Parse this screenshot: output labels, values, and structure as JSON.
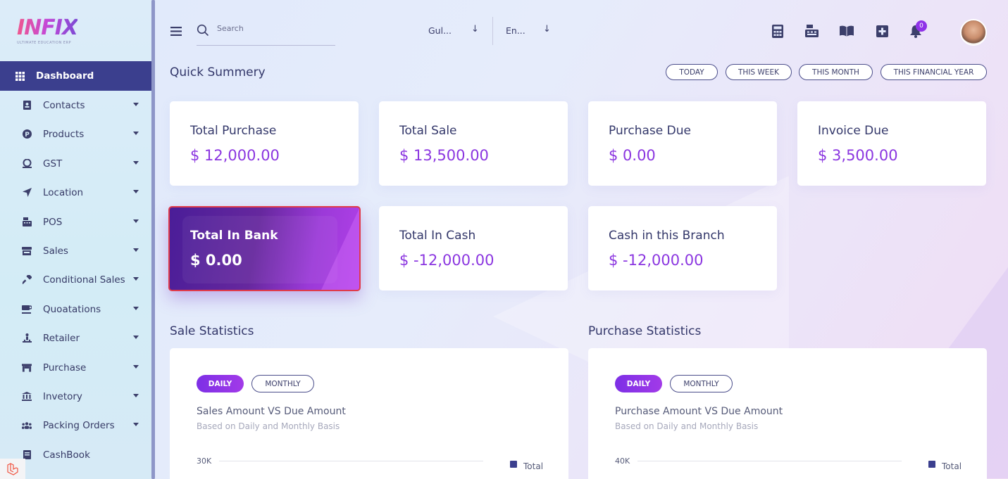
{
  "brand": {
    "logo": "INFIX",
    "tagline": "ULTIMATE EDUCATION ERP"
  },
  "sidebar": {
    "active": {
      "label": "Dashboard",
      "icon": "grid-icon"
    },
    "items": [
      {
        "label": "Contacts",
        "icon": "contact-book-icon"
      },
      {
        "label": "Products",
        "icon": "product-p-icon"
      },
      {
        "label": "GST",
        "icon": "tax-coin-icon"
      },
      {
        "label": "Location",
        "icon": "location-arrow-icon"
      },
      {
        "label": "POS",
        "icon": "cash-register-icon"
      },
      {
        "label": "Sales",
        "icon": "store-icon"
      },
      {
        "label": "Conditional Sales",
        "icon": "hammer-icon"
      },
      {
        "label": "Quoatations",
        "icon": "coffee-cup-icon"
      },
      {
        "label": "Retailer",
        "icon": "person-dolly-icon"
      },
      {
        "label": "Purchase",
        "icon": "shop-icon"
      },
      {
        "label": "Invetory",
        "icon": "bank-icon"
      },
      {
        "label": "Packing Orders",
        "icon": "users-icon"
      },
      {
        "label": "CashBook",
        "icon": "book-icon"
      }
    ]
  },
  "header": {
    "search_placeholder": "Search",
    "branch_select": "Gul...",
    "language_select": "En...",
    "notification_count": "0"
  },
  "summary": {
    "title": "Quick Summery",
    "filters": [
      "TODAY",
      "THIS WEEK",
      "THIS MONTH",
      "THIS FINANCIAL YEAR"
    ],
    "cards": [
      {
        "title": "Total Purchase",
        "value": "$ 12,000.00"
      },
      {
        "title": "Total Sale",
        "value": "$ 13,500.00"
      },
      {
        "title": "Purchase Due",
        "value": "$ 0.00"
      },
      {
        "title": "Invoice Due",
        "value": "$ 3,500.00"
      },
      {
        "title": "Total In Bank",
        "value": "$ 0.00"
      },
      {
        "title": "Total In Cash",
        "value": "$ -12,000.00"
      },
      {
        "title": "Cash in this Branch",
        "value": "$ -12,000.00"
      }
    ]
  },
  "stats": [
    {
      "heading": "Sale Statistics",
      "toggle_on": "DAILY",
      "toggle_off": "MONTHLY",
      "chart_title": "Sales Amount VS Due Amount",
      "chart_subtitle": "Based on Daily and Monthly Basis",
      "y_top_tick": "30K",
      "legend": "Total"
    },
    {
      "heading": "Purchase Statistics",
      "toggle_on": "DAILY",
      "toggle_off": "MONTHLY",
      "chart_title": "Purchase Amount VS Due Amount",
      "chart_subtitle": "Based on Daily and Monthly Basis",
      "y_top_tick": "40K",
      "legend": "Total"
    }
  ],
  "colors": {
    "accent": "#8b36e0",
    "nav_active": "#3b3f8e",
    "text": "#33376a"
  }
}
